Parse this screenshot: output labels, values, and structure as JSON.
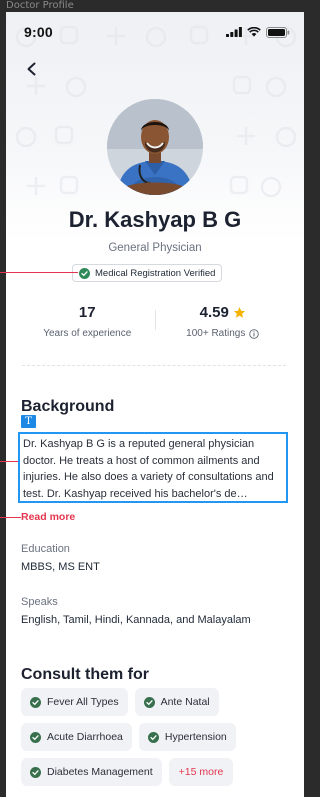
{
  "frame": {
    "label": "Doctor Profile"
  },
  "status_bar": {
    "time": "9:00"
  },
  "doctor": {
    "name": "Dr. Kashyap B G",
    "specialty": "General Physician",
    "verified_label": "Medical Registration Verified"
  },
  "stats": {
    "experience_value": "17",
    "experience_label": "Years of experience",
    "rating_value": "4.59",
    "rating_label": "100+ Ratings"
  },
  "background": {
    "title": "Background",
    "bio": "Dr. Kashyap B G is a reputed general physician doctor. He treats a host of common ailments and injuries. He also does a variety of consultations and test. Dr. Kashyap received his bachelor's de…",
    "read_more": "Read more"
  },
  "education": {
    "label": "Education",
    "value": "MBBS, MS ENT"
  },
  "speaks": {
    "label": "Speaks",
    "value": "English, Tamil, Hindi, Kannada, and Malayalam"
  },
  "consult": {
    "title": "Consult them for",
    "chips": [
      "Fever All Types",
      "Ante Natal",
      "Acute Diarrhoea",
      "Hypertension",
      "Diabetes Management"
    ],
    "more": "+15 more"
  },
  "colors": {
    "accent_red": "#e3364e",
    "verified_green": "#2f8a5a",
    "selection_blue": "#2196f3",
    "star": "#f5b301"
  },
  "icons": [
    "back-arrow-icon",
    "signal-icon",
    "wifi-icon",
    "battery-icon",
    "check-circle-icon",
    "star-icon",
    "info-icon",
    "text-tool-icon"
  ]
}
